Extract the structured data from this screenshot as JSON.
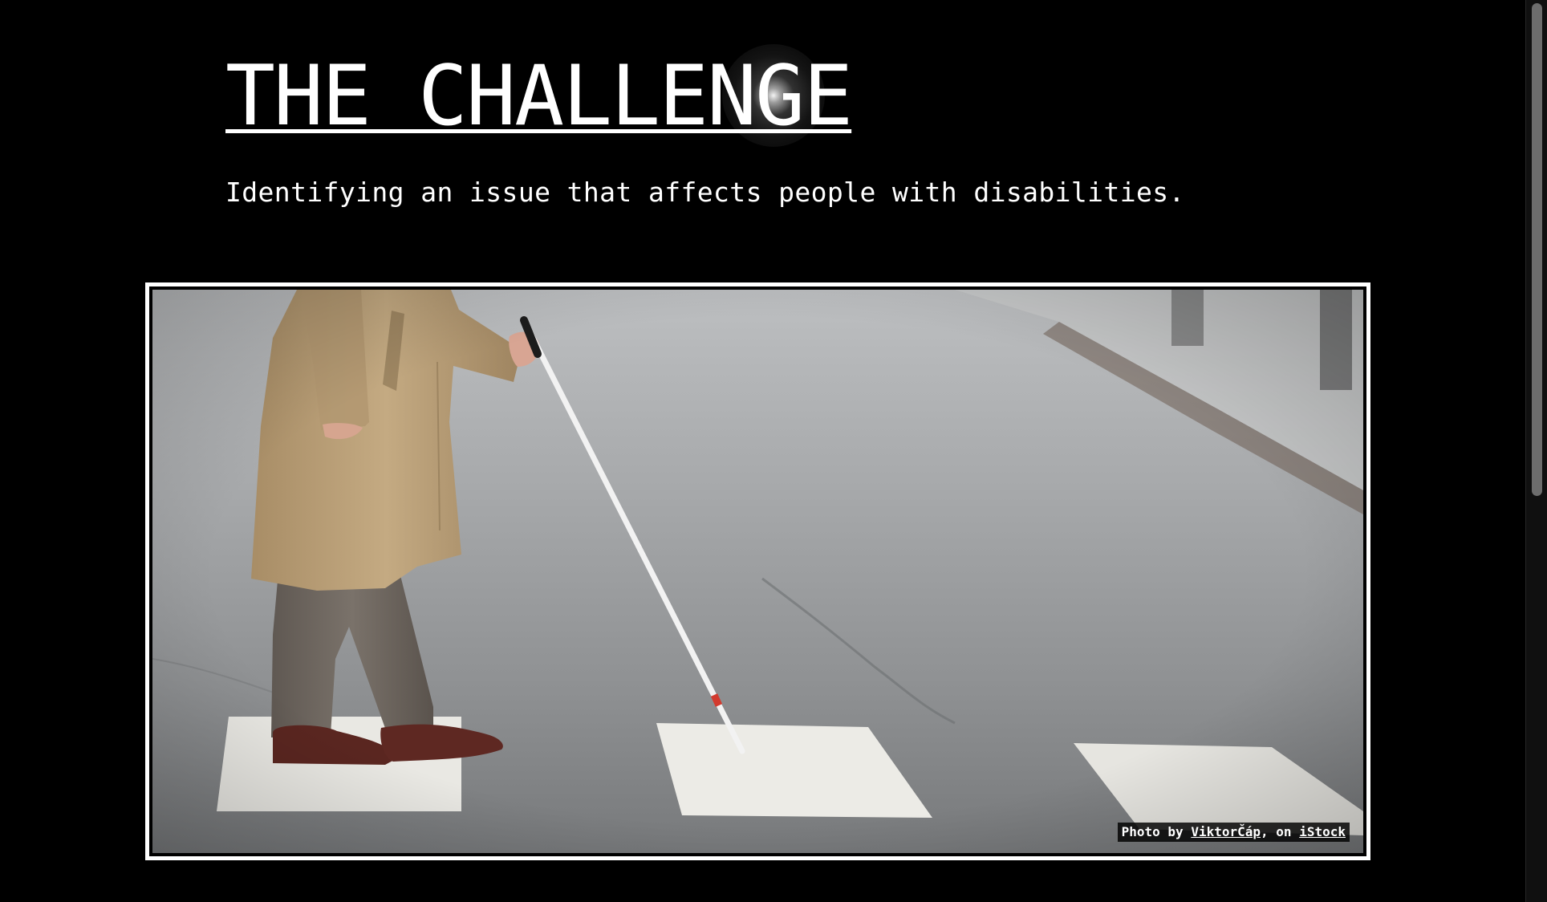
{
  "header": {
    "title": "THE CHALLENGE",
    "subtitle": "Identifying an issue that affects people with disabilities."
  },
  "photo": {
    "credit_prefix": "Photo by ",
    "credit_author": "ViktorČáp",
    "credit_middle": ", on ",
    "credit_source": "iStock"
  },
  "colors": {
    "background": "#000000",
    "text": "#ffffff",
    "frame": "#ffffff",
    "coat": "#b99e76",
    "trousers": "#6f665f",
    "cane": "#f2f2f2",
    "cane_tip": "#d23a2e"
  },
  "scrollbar": {
    "position_fraction": 0.0,
    "visible_fraction": 0.55
  }
}
